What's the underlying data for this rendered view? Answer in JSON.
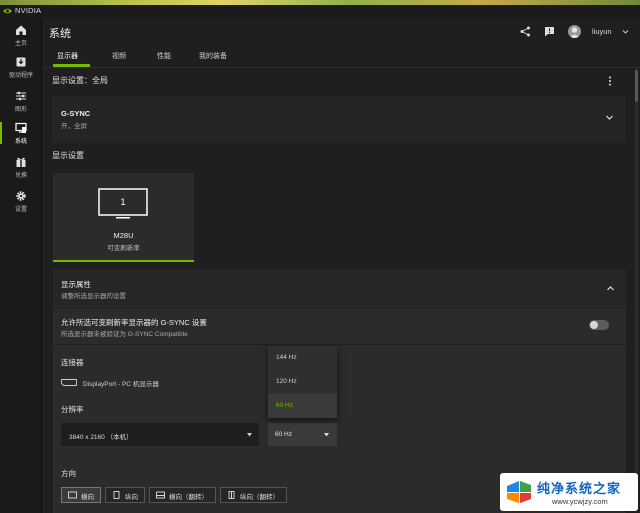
{
  "titlebar": {
    "app_name": "NVIDIA"
  },
  "sidebar": {
    "items": [
      {
        "label": "主页",
        "icon": "home-icon"
      },
      {
        "label": "驱动程序",
        "icon": "driver-icon"
      },
      {
        "label": "图形",
        "icon": "sliders-icon"
      },
      {
        "label": "系统",
        "icon": "monitor-icon",
        "active": true
      },
      {
        "label": "兑换",
        "icon": "gift-icon"
      },
      {
        "label": "设置",
        "icon": "gear-icon"
      }
    ]
  },
  "header": {
    "title": "系统",
    "username": "liuyun"
  },
  "tabs": [
    "显示器",
    "视频",
    "性能",
    "我的装备"
  ],
  "global": {
    "label": "显示设置：全局"
  },
  "gsync": {
    "title": "G-SYNC",
    "status": "开，全屏"
  },
  "display_settings": {
    "label": "显示设置"
  },
  "monitor": {
    "number": "1",
    "name": "M28U",
    "subtitle": "可变刷新率"
  },
  "properties": {
    "title": "显示属性",
    "subtitle": "调整所选显示器的设置",
    "allow_label": "允许所选可变刷新率显示器的 G-SYNC 设置",
    "allow_sub": "所选显示器未被验证为 G-SYNC Compatible",
    "connector_label": "连接器",
    "connector_value": "DisplayPort - PC 机显示器",
    "refresh_label": "分辨率",
    "resolution_value": "3840 x 2160 （本机）",
    "refresh_value": "60 Hz",
    "orientation_label": "方向",
    "orientations": [
      "横向",
      "纵向",
      "横向（翻转）",
      "纵向（翻转）"
    ]
  },
  "dropdown": {
    "options": [
      "144 Hz",
      "120 Hz",
      "60 Hz"
    ],
    "selected": "60 Hz"
  },
  "watermark": {
    "title": "纯净系统之家",
    "url": "www.ycwjzy.com"
  },
  "colors": {
    "accent": "#76b900",
    "bg": "#1f1f1f",
    "card": "#252525"
  }
}
